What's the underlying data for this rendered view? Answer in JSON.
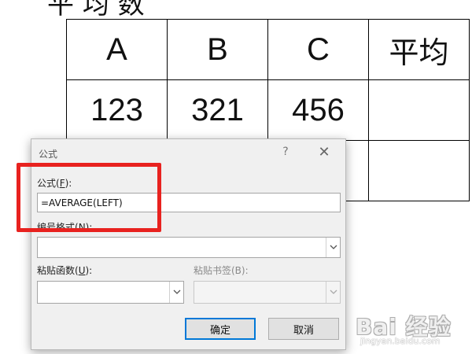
{
  "document": {
    "heading_fragment": "平 均 数",
    "table": {
      "rows": [
        [
          "A",
          "B",
          "C",
          "平均"
        ],
        [
          "123",
          "321",
          "456",
          ""
        ],
        [
          "",
          "",
          "",
          ""
        ]
      ]
    }
  },
  "dialog": {
    "title": "公式",
    "help_label": "?",
    "close_label": "✕",
    "formula_label_prefix": "公式(",
    "formula_label_key": "F",
    "formula_label_suffix": "):",
    "formula_value": "=AVERAGE(LEFT)",
    "number_format_label_prefix": "编号格式(",
    "number_format_label_key": "N",
    "number_format_label_suffix": "):",
    "number_format_value": "",
    "paste_function_label_prefix": "粘贴函数(",
    "paste_function_label_key": "U",
    "paste_function_label_suffix": "):",
    "paste_function_value": "",
    "paste_bookmark_label": "粘贴书签(B):",
    "paste_bookmark_value": "",
    "ok_label": "确定",
    "cancel_label": "取消"
  },
  "annotation": {
    "color": "#e8221f"
  },
  "watermark": {
    "brand": "Bai 经验",
    "url": "jingyan.baidu.com"
  }
}
